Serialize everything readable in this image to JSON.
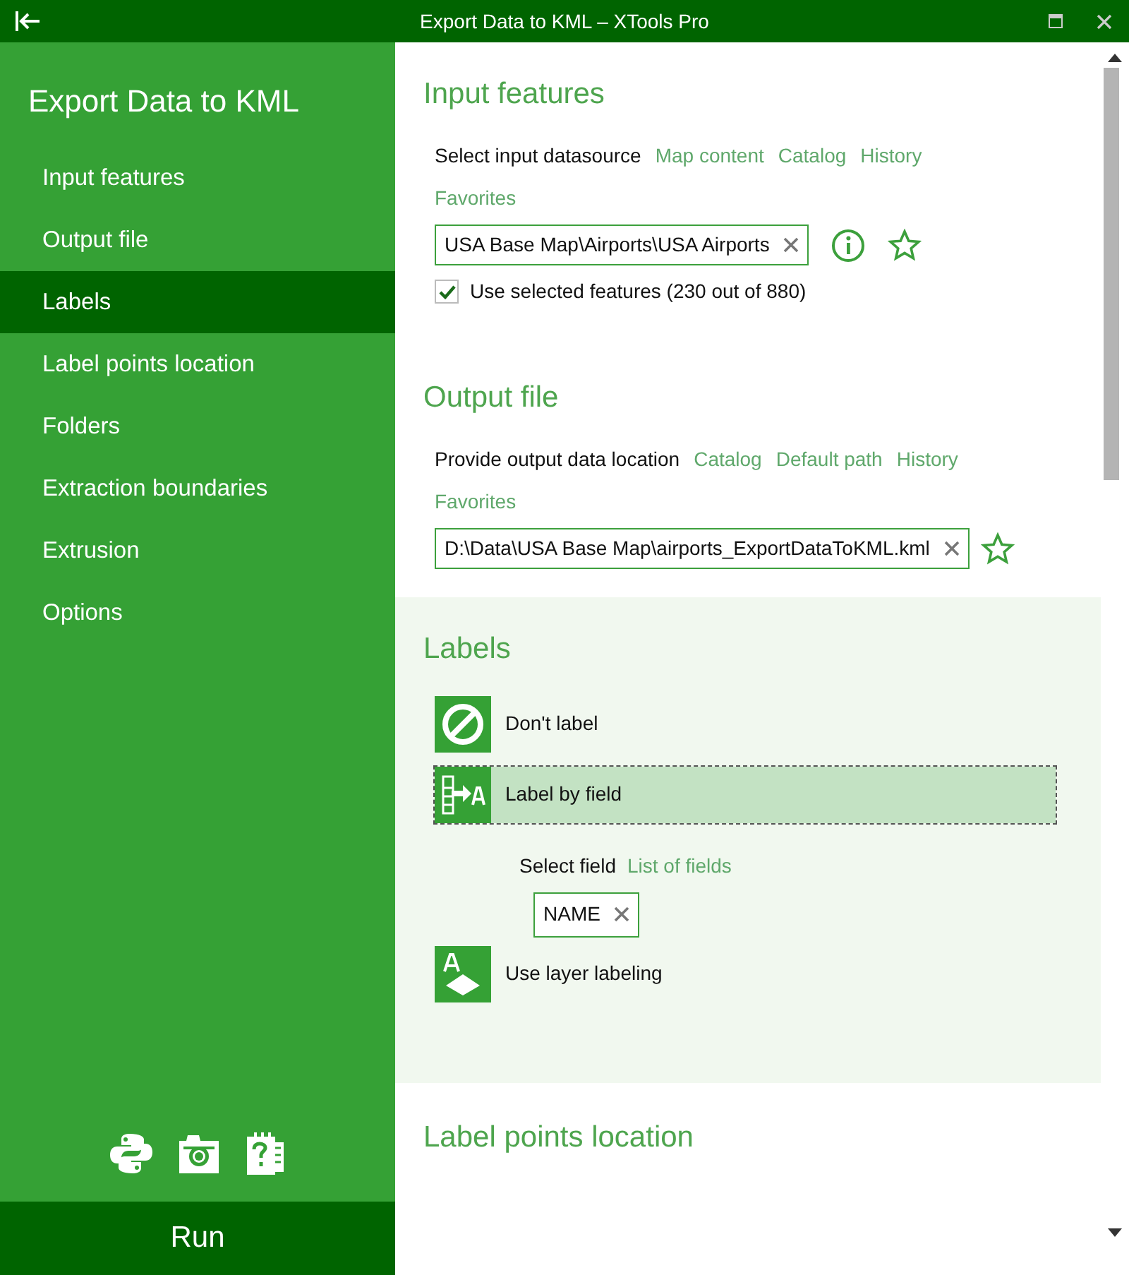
{
  "window": {
    "title": "Export Data to KML – XTools Pro"
  },
  "sidebar": {
    "title": "Export Data to KML",
    "items": [
      {
        "label": "Input features",
        "selected": false
      },
      {
        "label": "Output file",
        "selected": false
      },
      {
        "label": "Labels",
        "selected": true
      },
      {
        "label": "Label points location",
        "selected": false
      },
      {
        "label": "Folders",
        "selected": false
      },
      {
        "label": "Extraction boundaries",
        "selected": false
      },
      {
        "label": "Extrusion",
        "selected": false
      },
      {
        "label": "Options",
        "selected": false
      }
    ],
    "run_button": "Run"
  },
  "input_features": {
    "heading": "Input features",
    "prompt": "Select input datasource",
    "links": [
      "Map content",
      "Catalog",
      "History",
      "Favorites"
    ],
    "value": "USA Base Map\\Airports\\USA Airports",
    "use_selected": {
      "label": "Use selected features (230 out of 880)",
      "checked": true
    }
  },
  "output_file": {
    "heading": "Output file",
    "prompt": "Provide output data location",
    "links": [
      "Catalog",
      "Default path",
      "History",
      "Favorites"
    ],
    "value": "D:\\Data\\USA Base Map\\airports_ExportDataToKML.kml"
  },
  "labels": {
    "heading": "Labels",
    "options": [
      {
        "kind": "none",
        "label": "Don't label",
        "selected": false
      },
      {
        "kind": "field",
        "label": "Label by field",
        "selected": true
      },
      {
        "kind": "layer",
        "label": "Use layer labeling",
        "selected": false
      }
    ],
    "field_prompt": "Select field",
    "field_link": "List of fields",
    "field_value": "NAME"
  },
  "label_points_location": {
    "heading": "Label points location"
  }
}
